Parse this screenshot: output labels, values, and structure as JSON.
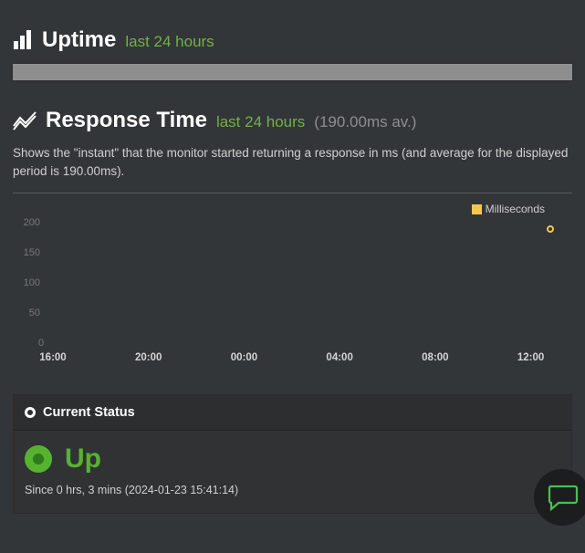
{
  "uptime": {
    "title": "Uptime",
    "subtitle": "last 24 hours"
  },
  "response_time": {
    "title": "Response Time",
    "subtitle": "last 24 hours",
    "avg_label": "(190.00ms av.)",
    "description": "Shows the \"instant\" that the monitor started returning a response in ms (and average for the displayed period is 190.00ms).",
    "legend_label": "Milliseconds"
  },
  "chart_data": {
    "type": "scatter",
    "xlabel": "",
    "ylabel": "",
    "ylim": [
      0,
      200
    ],
    "y_ticks": [
      0,
      50,
      100,
      150,
      200
    ],
    "x_ticks": [
      "16:00",
      "20:00",
      "00:00",
      "04:00",
      "08:00",
      "12:00"
    ],
    "series": [
      {
        "name": "Milliseconds",
        "x": [
          "15:38"
        ],
        "y": [
          190
        ]
      }
    ]
  },
  "current_status": {
    "header": "Current Status",
    "status": "Up",
    "since": "Since 0 hrs, 3 mins (2024-01-23 15:41:14)"
  }
}
